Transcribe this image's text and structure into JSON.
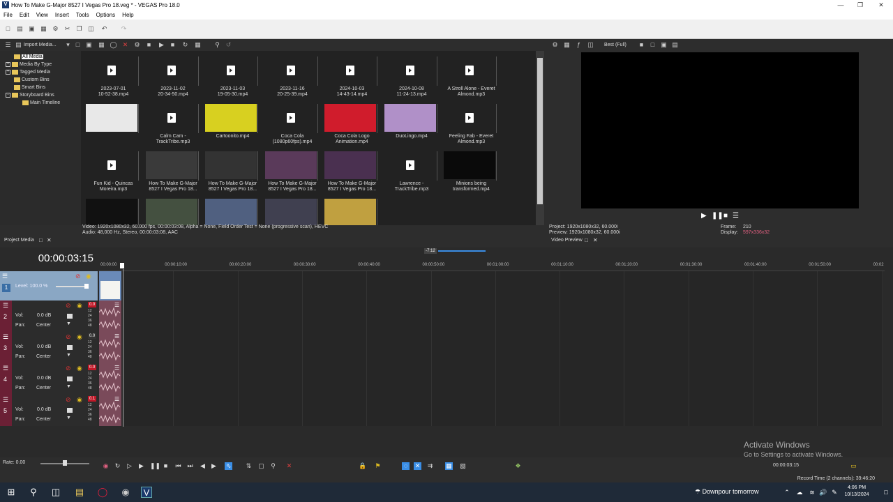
{
  "window": {
    "title": "How To Make G-Major 8527 I Vegas Pro 18.veg * - VEGAS Pro 18.0",
    "app_badge": "V"
  },
  "menu": [
    "File",
    "Edit",
    "View",
    "Insert",
    "Tools",
    "Options",
    "Help"
  ],
  "project_media": {
    "import_label": "Import Media...",
    "tab_label": "Project Media",
    "tree": [
      {
        "label": "All Media",
        "selected": true
      },
      {
        "label": "Media By Type"
      },
      {
        "label": "Tagged Media"
      },
      {
        "label": "Custom Bins"
      },
      {
        "label": "Smart Bins"
      },
      {
        "label": "Storyboard Bins"
      },
      {
        "label": "Main Timeline"
      }
    ],
    "items": [
      {
        "name": "2023-07-01\n10-52-38.mp4",
        "kind": "doc"
      },
      {
        "name": "2023-11-02\n20-34-50.mp4",
        "kind": "doc"
      },
      {
        "name": "2023-11-03\n19-05-30.mp4",
        "kind": "doc"
      },
      {
        "name": "2023-11-16\n20-25-39.mp4",
        "kind": "doc"
      },
      {
        "name": "2024-10-03\n14-43-14.mp4",
        "kind": "doc"
      },
      {
        "name": "2024-10-08\n11-24-13.mp4",
        "kind": "doc"
      },
      {
        "name": "A Stroll Alone - Everet\nAlmond.mp3",
        "kind": "doc"
      },
      {
        "name": "",
        "kind": "thumb",
        "color": "#e8e8e8"
      },
      {
        "name": "Calm Cam -\nTrackTribe.mp3",
        "kind": "doc"
      },
      {
        "name": "Cartoonito.mp4",
        "kind": "thumb",
        "color": "#d8d020"
      },
      {
        "name": "Coca Cola\n(1080p60fps).mp4",
        "kind": "doc"
      },
      {
        "name": "Coca Cola Logo\nAnimation.mp4",
        "kind": "thumb",
        "color": "#d01c2c"
      },
      {
        "name": "DuoLingo.mp4",
        "kind": "thumb",
        "color": "#b090c8"
      },
      {
        "name": "Feeling Fab - Everet\nAlmond.mp3",
        "kind": "doc"
      },
      {
        "name": "Fun Kid - Quincas\nMoreira.mp3",
        "kind": "doc"
      },
      {
        "name": "How To Make G-Major\n8527 I Vegas Pro 18...",
        "kind": "thumb",
        "color": "#3a3a3a"
      },
      {
        "name": "How To Make G-Major\n8527 I Vegas Pro 18...",
        "kind": "thumb",
        "color": "#333333"
      },
      {
        "name": "How To Make G-Major\n8527 I Vegas Pro 18...",
        "kind": "thumb",
        "color": "#5a3a5a"
      },
      {
        "name": "How To Make G-Major\n8527 I Vegas Pro 18...",
        "kind": "thumb",
        "color": "#4a3050"
      },
      {
        "name": "Lawrence -\nTrackTribe.mp3",
        "kind": "doc"
      },
      {
        "name": "Minions being\ntransformed.mp4",
        "kind": "thumb",
        "color": "#0a0a0a"
      },
      {
        "name": "",
        "kind": "thumb",
        "color": "#111111"
      },
      {
        "name": "",
        "kind": "thumb",
        "color": "#445040"
      },
      {
        "name": "",
        "kind": "thumb",
        "color": "#506080"
      },
      {
        "name": "",
        "kind": "thumb",
        "color": "#404050"
      },
      {
        "name": "",
        "kind": "thumb",
        "color": "#c0a040"
      }
    ],
    "info_line1": "Video: 1920x1080x32, 60.000 fps, 00:00:03:08, Alpha = None, Field Order Test = None (progressive scan), HEVC",
    "info_line2": "Audio: 48,000 Hz, Stereo, 00:00:03:08, AAC"
  },
  "preview": {
    "quality": "Best (Full)",
    "tab_label": "Video Preview",
    "project": "Project:   1920x1080x32, 60.000i",
    "preview_line": "Preview:  1920x1080x32, 60.000i",
    "frame_label": "Frame:",
    "frame_value": "210",
    "display_label": "Display:",
    "display_value": "597x336x32"
  },
  "timeline": {
    "timecode": "00:00:03:15",
    "marker": "-7:12",
    "ticks": [
      "00:00:00",
      "00:00:10:00",
      "00:00:20:00",
      "00:00:30:00",
      "00:00:40:00",
      "00:00:50:00",
      "00:01:00:00",
      "00:01:10:00",
      "00:01:20:00",
      "00:01:30:00",
      "00:01:40:00",
      "00:01:50:00",
      "00:02"
    ],
    "video_track": {
      "level": "Level: 100.0 %"
    },
    "audio_tracks": [
      {
        "num": "2",
        "vol_label": "Vol:",
        "vol": "0.0 dB",
        "pan_label": "Pan:",
        "pan": "Center",
        "peak": "0.0"
      },
      {
        "num": "3",
        "vol_label": "Vol:",
        "vol": "0.0 dB",
        "pan_label": "Pan:",
        "pan": "Center",
        "peak": "0.0"
      },
      {
        "num": "4",
        "vol_label": "Vol:",
        "vol": "0.0 dB",
        "pan_label": "Pan:",
        "pan": "Center",
        "peak": "0.0"
      },
      {
        "num": "5",
        "vol_label": "Vol:",
        "vol": "0.0 dB",
        "pan_label": "Pan:",
        "pan": "Center",
        "peak": "0.1"
      }
    ],
    "meter_labels": [
      "12",
      "24",
      "36",
      "48"
    ],
    "rate": "Rate: 0.00",
    "end_time": "00:00:03:15",
    "record_time": "Record Time (2 channels): 39:46:20"
  },
  "watermark": {
    "line1": "Activate Windows",
    "line2": "Go to Settings to activate Windows."
  },
  "taskbar": {
    "weather": "Downpour tomorrow",
    "time": "4:06 PM",
    "date": "10/13/2024"
  },
  "colors": {
    "accent": "#3a8ee6",
    "video_header": "#8aa7c4",
    "audio_strip": "#6b2035",
    "warning_red": "#d01c2c"
  }
}
